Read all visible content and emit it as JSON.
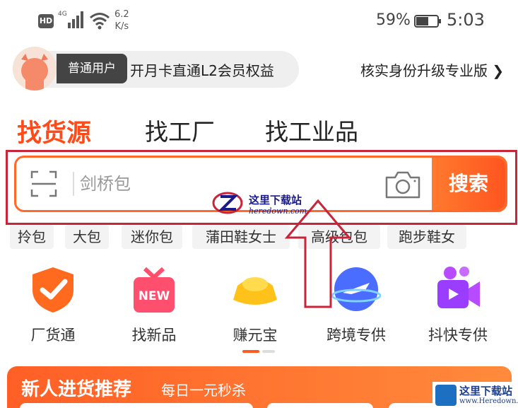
{
  "status_bar": {
    "hd": "HD",
    "network": "4G",
    "speed_value": "6.2",
    "speed_unit": "K/s",
    "battery_pct": "59%",
    "battery_level": 0.59,
    "time": "5:03"
  },
  "member": {
    "user_badge": "普通用户",
    "promo_text": "开月卡直通L2会员权益",
    "upgrade_text": "核实身份升级专业版 ❯"
  },
  "tabs": [
    "找货源",
    "找工厂",
    "找工业品"
  ],
  "search": {
    "placeholder": "剑桥包",
    "button_label": "搜索"
  },
  "tags": [
    "拎包",
    "大包",
    "迷你包",
    "蒲田鞋女士",
    "高级包包",
    "跑步鞋女"
  ],
  "categories": [
    {
      "label": "厂货通",
      "icon": "shield-check-icon"
    },
    {
      "label": "找新品",
      "icon": "new-gift-icon",
      "badge": "NEW"
    },
    {
      "label": "赚元宝",
      "icon": "gold-ingot-icon"
    },
    {
      "label": "跨境专供",
      "icon": "airplane-globe-icon"
    },
    {
      "label": "抖快专供",
      "icon": "video-camera-icon"
    }
  ],
  "pager": {
    "active_index": 0,
    "pages": 2
  },
  "promo": {
    "title": "新人进货推荐",
    "subtitle": "每日一元秒杀"
  },
  "colors": {
    "accent": "#ff4a1a",
    "search_border": "#ff6a2a",
    "annotation_red": "#c8243a"
  },
  "watermark": {
    "center_cn": "这里下载站",
    "center_url": "heredown.com",
    "corner_cn": "这里下载站",
    "corner_url": "www.Heredown.com"
  }
}
